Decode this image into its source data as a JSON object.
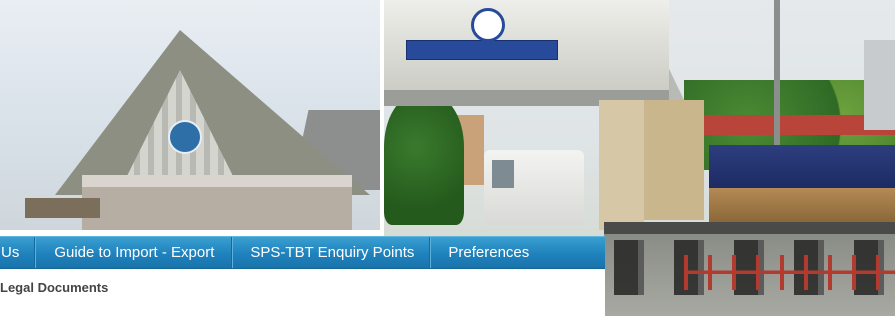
{
  "navigation": {
    "items": [
      {
        "label": "Us"
      },
      {
        "label": "Guide to Import - Export"
      },
      {
        "label": "SPS-TBT Enquiry Points"
      },
      {
        "label": "Preferences"
      }
    ]
  },
  "submenu": {
    "link_label": "Legal Documents"
  },
  "banner": {
    "photos": [
      "customs-building-photo",
      "border-checkpoint-photo"
    ]
  },
  "colors": {
    "nav_bar": "#1f82bd",
    "nav_text": "#ffffff",
    "submenu_text": "#444444"
  }
}
